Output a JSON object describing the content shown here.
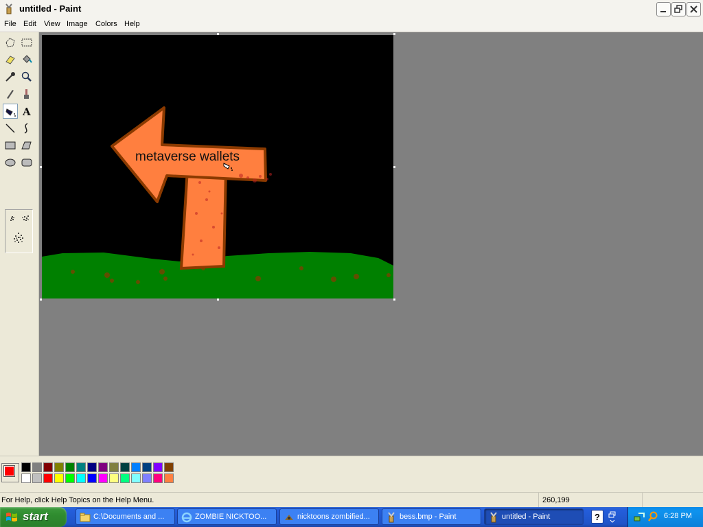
{
  "window": {
    "title": "untitled - Paint"
  },
  "menu": [
    "File",
    "Edit",
    "View",
    "Image",
    "Colors",
    "Help"
  ],
  "tools": [
    {
      "name": "free-form-select",
      "icon": "free-select-icon"
    },
    {
      "name": "select",
      "icon": "rect-select-icon"
    },
    {
      "name": "eraser",
      "icon": "eraser-icon"
    },
    {
      "name": "fill-with-color",
      "icon": "fill-bucket-icon"
    },
    {
      "name": "pick-color",
      "icon": "eyedropper-icon"
    },
    {
      "name": "magnifier",
      "icon": "magnifier-icon"
    },
    {
      "name": "pencil",
      "icon": "pencil-icon"
    },
    {
      "name": "brush",
      "icon": "brush-icon"
    },
    {
      "name": "airbrush",
      "icon": "airbrush-icon",
      "selected": true
    },
    {
      "name": "text",
      "icon": "text-icon"
    },
    {
      "name": "line",
      "icon": "line-icon"
    },
    {
      "name": "curve",
      "icon": "curve-icon"
    },
    {
      "name": "rectangle",
      "icon": "rectangle-icon"
    },
    {
      "name": "polygon",
      "icon": "polygon-icon"
    },
    {
      "name": "ellipse",
      "icon": "ellipse-icon"
    },
    {
      "name": "rounded-rectangle",
      "icon": "rounded-rect-icon"
    }
  ],
  "canvas": {
    "sign_text": "metaverse wallets",
    "colors": {
      "sky": "#000000",
      "grass": "#008000",
      "sign": "#ff7f3f",
      "outline": "#8b3a00"
    }
  },
  "palette": {
    "foreground": "#ff0000",
    "background": "#ffffff",
    "row1": [
      "#000000",
      "#808080",
      "#800000",
      "#808000",
      "#008000",
      "#008080",
      "#000080",
      "#800080",
      "#808040",
      "#004040",
      "#0080ff",
      "#004080",
      "#8000ff",
      "#804000"
    ],
    "row2": [
      "#ffffff",
      "#c0c0c0",
      "#ff0000",
      "#ffff00",
      "#00ff00",
      "#00ffff",
      "#0000ff",
      "#ff00ff",
      "#ffff80",
      "#00ff80",
      "#80ffff",
      "#8080ff",
      "#ff0080",
      "#ff8040"
    ]
  },
  "status": {
    "help_text": "For Help, click Help Topics on the Help Menu.",
    "coords": "260,199"
  },
  "taskbar": {
    "start_label": "start",
    "tasks": [
      {
        "label": "C:\\Documents and ...",
        "icon": "folder-icon"
      },
      {
        "label": "ZOMBIE NICKTOO...",
        "icon": "ie-icon"
      },
      {
        "label": "nicktoons zombified...",
        "icon": "image-icon"
      },
      {
        "label": "bess.bmp - Paint",
        "icon": "paint-icon"
      },
      {
        "label": "untitled - Paint",
        "icon": "paint-icon",
        "active": true
      }
    ],
    "help_label": "?",
    "clock": "6:28 PM"
  }
}
